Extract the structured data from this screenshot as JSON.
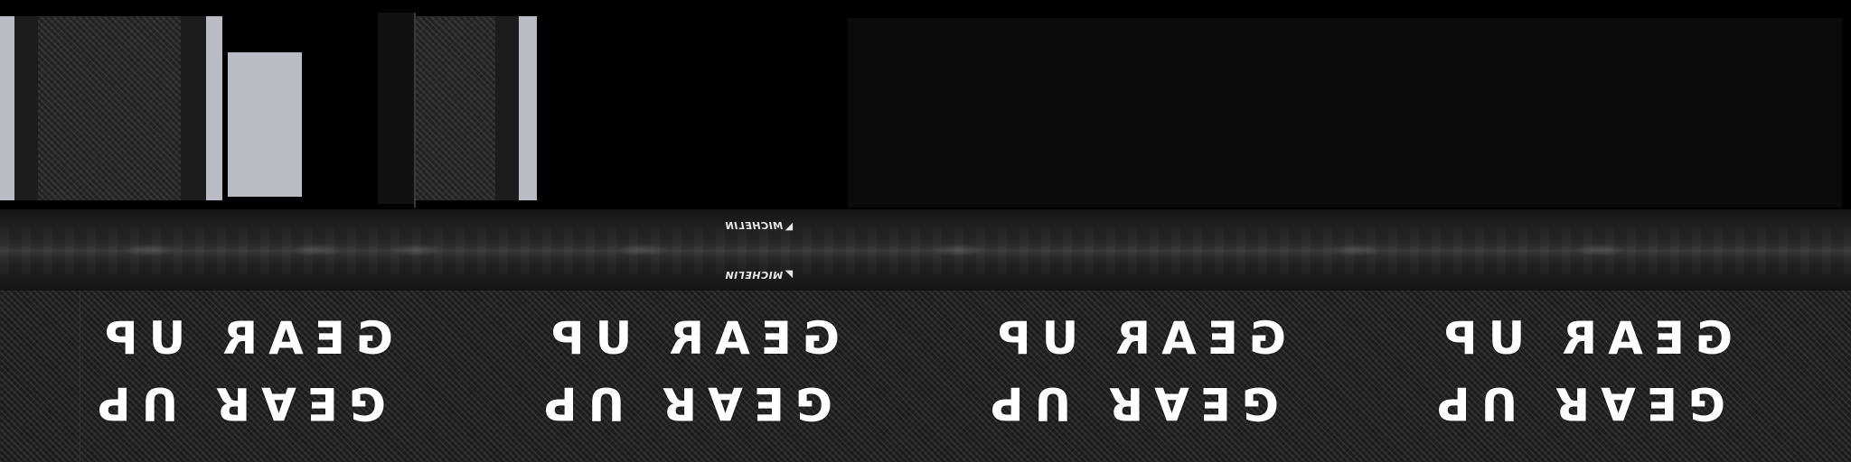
{
  "tire_strip": {
    "logo_top": "MICHELIN",
    "logo_bottom": "MICHELIN"
  },
  "banner": {
    "slogans": [
      {
        "top": "GEAR UP",
        "bottom": "GEAR UP"
      },
      {
        "top": "GEAR UP",
        "bottom": "GEAR UP"
      },
      {
        "top": "GEAR UP",
        "bottom": "GEAR UP"
      },
      {
        "top": "GEAR UP",
        "bottom": "GEAR UP"
      }
    ]
  },
  "colors": {
    "background": "#000000",
    "silver": "#b9bdc3",
    "carbon": "#2a2a2a",
    "panel": "#0b0b0b",
    "text": "#ffffff"
  }
}
